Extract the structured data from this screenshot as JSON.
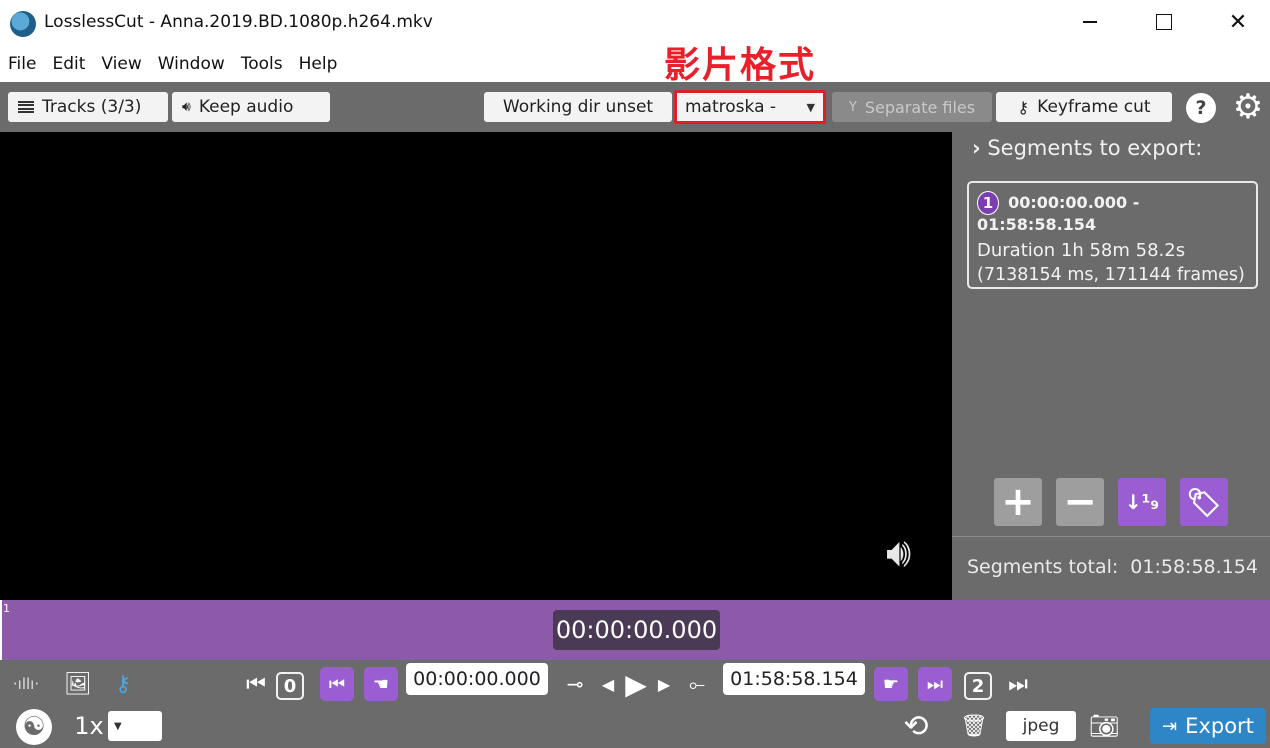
{
  "window": {
    "title": "LosslessCut - Anna.2019.BD.1080p.h264.mkv",
    "minimize_icon": "minimize-icon",
    "maximize_icon": "maximize-icon",
    "close_glyph": "✕"
  },
  "menu": [
    "File",
    "Edit",
    "View",
    "Window",
    "Tools",
    "Help"
  ],
  "annotation": "影片格式",
  "toolbar": {
    "tracks_label": "Tracks (3/3)",
    "keep_audio_label": "Keep audio",
    "working_dir_label": "Working dir unset",
    "format_value": "matroska -",
    "separate_files_label": "Separate files",
    "keyframe_cut_label": "Keyframe cut",
    "help_glyph": "?",
    "gear_glyph": "⚙"
  },
  "segments_panel": {
    "header": "Segments to export:",
    "segments": [
      {
        "number": "1",
        "range": "00:00:00.000 - 01:58:58.154",
        "duration": "Duration 1h 58m 58.2s",
        "detail": "(7138154 ms, 171144 frames)"
      }
    ],
    "add_glyph": "+",
    "remove_glyph": "−",
    "sort_glyph": "↓¹₉",
    "tag_glyph": "🏷",
    "total_label": "Segments total:",
    "total_value": "01:58:58.154"
  },
  "timeline": {
    "marker": "1",
    "current_time": "00:00:00.000"
  },
  "controls": {
    "start_segment_label": "0",
    "cut_start_time": "00:00:00.000",
    "cut_end_time": "01:58:58.154",
    "end_segment_label": "2",
    "speed_label": "1x",
    "capture_format": "jpeg",
    "export_label": "Export"
  },
  "colors": {
    "panel_bg": "#6b6b6b",
    "accent_purple": "#9a5ed2",
    "timeline_purple": "#8c5aa8",
    "export_blue": "#2f86c6",
    "annotation_red": "#e8202a"
  }
}
